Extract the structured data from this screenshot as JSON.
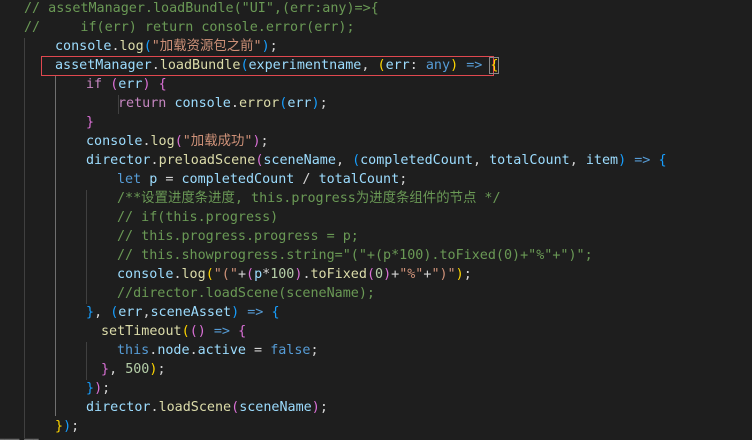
{
  "editor": {
    "lines": [
      {
        "tokens": [
          {
            "t": "// assetManager.loadBundle(\"UI\",(err:any)=>{",
            "c": "cmt"
          }
        ]
      },
      {
        "tokens": [
          {
            "t": "//     if(err) return console.error(err);",
            "c": "cmt"
          }
        ]
      },
      {
        "tokens": [
          {
            "t": "console",
            "c": "var"
          },
          {
            "t": ".",
            "c": "pn"
          },
          {
            "t": "log",
            "c": "fn"
          },
          {
            "t": "(",
            "c": "b3"
          },
          {
            "t": "\"加载资源包之前\"",
            "c": "str"
          },
          {
            "t": ")",
            "c": "b3"
          },
          {
            "t": ";",
            "c": "pn"
          }
        ]
      },
      {
        "tokens": [
          {
            "t": "assetManager",
            "c": "var"
          },
          {
            "t": ".",
            "c": "pn"
          },
          {
            "t": "loadBundle",
            "c": "fn"
          },
          {
            "t": "(",
            "c": "b3"
          },
          {
            "t": "experimentname",
            "c": "var"
          },
          {
            "t": ", ",
            "c": "pn"
          },
          {
            "t": "(",
            "c": "b1"
          },
          {
            "t": "err",
            "c": "var"
          },
          {
            "t": ": ",
            "c": "pn"
          },
          {
            "t": "any",
            "c": "kw"
          },
          {
            "t": ") ",
            "c": "b1"
          },
          {
            "t": "=>",
            "c": "kw"
          },
          {
            "t": " ",
            "c": "pn"
          },
          {
            "t": "{",
            "c": "b1",
            "cur": true
          }
        ]
      },
      {
        "tokens": [
          {
            "t": "if",
            "c": "ctl"
          },
          {
            "t": " ",
            "c": "pn"
          },
          {
            "t": "(",
            "c": "b2"
          },
          {
            "t": "err",
            "c": "var"
          },
          {
            "t": ")",
            "c": "b2"
          },
          {
            "t": " ",
            "c": "pn"
          },
          {
            "t": "{",
            "c": "b2"
          }
        ]
      },
      {
        "tokens": [
          {
            "t": "return",
            "c": "ctl"
          },
          {
            "t": " ",
            "c": "pn"
          },
          {
            "t": "console",
            "c": "var"
          },
          {
            "t": ".",
            "c": "pn"
          },
          {
            "t": "error",
            "c": "fn"
          },
          {
            "t": "(",
            "c": "b3"
          },
          {
            "t": "err",
            "c": "var"
          },
          {
            "t": ")",
            "c": "b3"
          },
          {
            "t": ";",
            "c": "pn"
          }
        ]
      },
      {
        "tokens": [
          {
            "t": "}",
            "c": "b2"
          }
        ]
      },
      {
        "tokens": [
          {
            "t": "console",
            "c": "var"
          },
          {
            "t": ".",
            "c": "pn"
          },
          {
            "t": "log",
            "c": "fn"
          },
          {
            "t": "(",
            "c": "b2"
          },
          {
            "t": "\"加载成功\"",
            "c": "str"
          },
          {
            "t": ")",
            "c": "b2"
          },
          {
            "t": ";",
            "c": "pn"
          }
        ]
      },
      {
        "tokens": [
          {
            "t": "director",
            "c": "var"
          },
          {
            "t": ".",
            "c": "pn"
          },
          {
            "t": "preloadScene",
            "c": "fn"
          },
          {
            "t": "(",
            "c": "b2"
          },
          {
            "t": "sceneName",
            "c": "var"
          },
          {
            "t": ", ",
            "c": "pn"
          },
          {
            "t": "(",
            "c": "b3"
          },
          {
            "t": "completedCount",
            "c": "var"
          },
          {
            "t": ", ",
            "c": "pn"
          },
          {
            "t": "totalCount",
            "c": "var"
          },
          {
            "t": ", ",
            "c": "pn"
          },
          {
            "t": "item",
            "c": "var"
          },
          {
            "t": ") ",
            "c": "b3"
          },
          {
            "t": "=>",
            "c": "kw"
          },
          {
            "t": " ",
            "c": "pn"
          },
          {
            "t": "{",
            "c": "b3"
          }
        ]
      },
      {
        "tokens": [
          {
            "t": "let",
            "c": "kw"
          },
          {
            "t": " ",
            "c": "pn"
          },
          {
            "t": "p",
            "c": "var"
          },
          {
            "t": " = ",
            "c": "pn"
          },
          {
            "t": "completedCount",
            "c": "var"
          },
          {
            "t": " / ",
            "c": "pn"
          },
          {
            "t": "totalCount",
            "c": "var"
          },
          {
            "t": ";",
            "c": "pn"
          }
        ]
      },
      {
        "tokens": [
          {
            "t": "/**设置进度条进度, this.progress为进度条组件的节点 */",
            "c": "cmt"
          }
        ]
      },
      {
        "tokens": [
          {
            "t": "// if(this.progress)",
            "c": "cmt"
          }
        ]
      },
      {
        "tokens": [
          {
            "t": "// this.progress.progress = p;",
            "c": "cmt"
          }
        ]
      },
      {
        "tokens": [
          {
            "t": "// this.showprogress.string=\"(\"+(p*100).toFixed(0)+\"%\"+\")\";",
            "c": "cmt"
          }
        ]
      },
      {
        "tokens": [
          {
            "t": "console",
            "c": "var"
          },
          {
            "t": ".",
            "c": "pn"
          },
          {
            "t": "log",
            "c": "fn"
          },
          {
            "t": "(",
            "c": "b1"
          },
          {
            "t": "\"(\"",
            "c": "str"
          },
          {
            "t": "+",
            "c": "pn"
          },
          {
            "t": "(",
            "c": "b2"
          },
          {
            "t": "p",
            "c": "var"
          },
          {
            "t": "*",
            "c": "pn"
          },
          {
            "t": "100",
            "c": "num"
          },
          {
            "t": ")",
            "c": "b2"
          },
          {
            "t": ".",
            "c": "pn"
          },
          {
            "t": "toFixed",
            "c": "fn"
          },
          {
            "t": "(",
            "c": "b2"
          },
          {
            "t": "0",
            "c": "num"
          },
          {
            "t": ")",
            "c": "b2"
          },
          {
            "t": "+",
            "c": "pn"
          },
          {
            "t": "\"%\"",
            "c": "str"
          },
          {
            "t": "+",
            "c": "pn"
          },
          {
            "t": "\")\"",
            "c": "str"
          },
          {
            "t": ")",
            "c": "b1"
          },
          {
            "t": ";",
            "c": "pn"
          }
        ]
      },
      {
        "tokens": [
          {
            "t": "//director.loadScene(sceneName);",
            "c": "cmt"
          }
        ]
      },
      {
        "tokens": [
          {
            "t": "}",
            "c": "b3"
          },
          {
            "t": ", ",
            "c": "pn"
          },
          {
            "t": "(",
            "c": "b3"
          },
          {
            "t": "err",
            "c": "var"
          },
          {
            "t": ",",
            "c": "pn"
          },
          {
            "t": "sceneAsset",
            "c": "var"
          },
          {
            "t": ") ",
            "c": "b3"
          },
          {
            "t": "=>",
            "c": "kw"
          },
          {
            "t": " ",
            "c": "pn"
          },
          {
            "t": "{",
            "c": "b3"
          }
        ]
      },
      {
        "tokens": [
          {
            "t": "setTimeout",
            "c": "fn"
          },
          {
            "t": "(",
            "c": "b1"
          },
          {
            "t": "()",
            "c": "b2"
          },
          {
            "t": " ",
            "c": "pn"
          },
          {
            "t": "=>",
            "c": "kw"
          },
          {
            "t": " ",
            "c": "pn"
          },
          {
            "t": "{",
            "c": "b2"
          }
        ]
      },
      {
        "tokens": [
          {
            "t": "this",
            "c": "kw"
          },
          {
            "t": ".",
            "c": "pn"
          },
          {
            "t": "node",
            "c": "var"
          },
          {
            "t": ".",
            "c": "pn"
          },
          {
            "t": "active",
            "c": "var"
          },
          {
            "t": " = ",
            "c": "pn"
          },
          {
            "t": "false",
            "c": "kw"
          },
          {
            "t": ";",
            "c": "pn"
          }
        ]
      },
      {
        "tokens": [
          {
            "t": "}",
            "c": "b2"
          },
          {
            "t": ", ",
            "c": "pn"
          },
          {
            "t": "500",
            "c": "num"
          },
          {
            "t": ")",
            "c": "b1"
          },
          {
            "t": ";",
            "c": "pn"
          }
        ]
      },
      {
        "tokens": [
          {
            "t": "}",
            "c": "b3"
          },
          {
            "t": ")",
            "c": "b2"
          },
          {
            "t": ";",
            "c": "pn"
          }
        ]
      },
      {
        "tokens": [
          {
            "t": "director",
            "c": "var"
          },
          {
            "t": ".",
            "c": "pn"
          },
          {
            "t": "loadScene",
            "c": "fn"
          },
          {
            "t": "(",
            "c": "b2"
          },
          {
            "t": "sceneName",
            "c": "var"
          },
          {
            "t": ")",
            "c": "b2"
          },
          {
            "t": ";",
            "c": "pn"
          }
        ]
      },
      {
        "tokens": [
          {
            "t": "}",
            "c": "b1"
          },
          {
            "t": ")",
            "c": "b3"
          },
          {
            "t": ";",
            "c": "pn"
          }
        ]
      }
    ]
  },
  "colors": {
    "background": "#1e1e1e",
    "highlight_box": "#e0484f"
  }
}
